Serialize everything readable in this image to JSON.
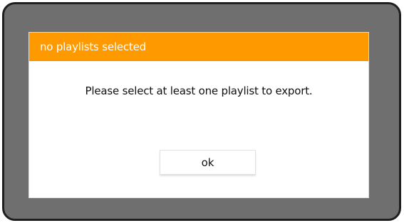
{
  "dialog": {
    "title": "no playlists selected",
    "message": "Please select at least one playlist to export.",
    "ok_label": "ok"
  },
  "colors": {
    "title_bar": "#ff9900",
    "frame": "#6f6f6f",
    "dialog_bg": "#ffffff"
  }
}
